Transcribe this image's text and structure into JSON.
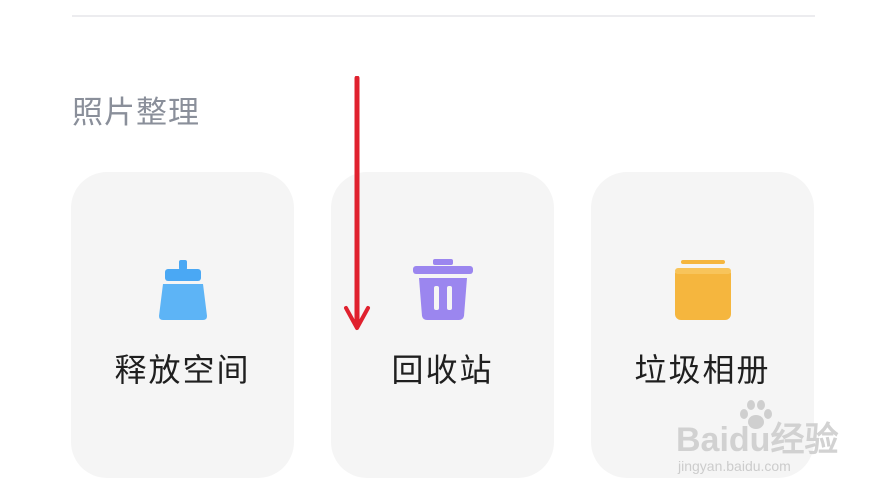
{
  "section": {
    "title": "照片整理"
  },
  "cards": [
    {
      "label": "释放空间",
      "icon": "broom-icon",
      "color": "#4aa8f4"
    },
    {
      "label": "回收站",
      "icon": "trash-bin-icon",
      "color": "#9b86ef"
    },
    {
      "label": "垃圾相册",
      "icon": "folder-icon",
      "color": "#f5b63e"
    }
  ],
  "annotation": {
    "arrow_color": "#e0212e"
  },
  "watermark": {
    "brand": "Baidu经验",
    "url": "jingyan.baidu.com"
  }
}
